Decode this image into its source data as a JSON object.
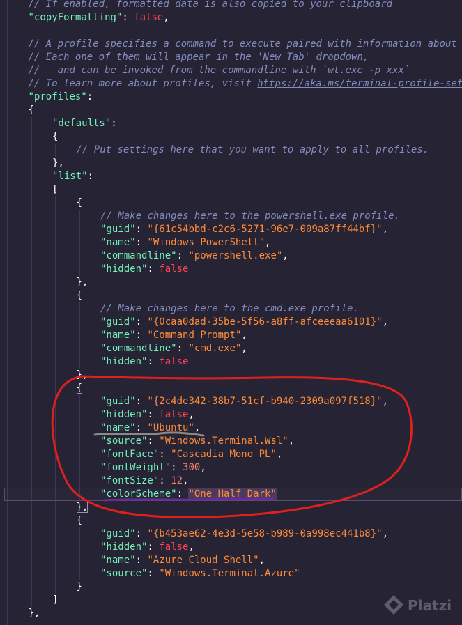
{
  "colors": {
    "background": "#262335",
    "comment": "#848bbd",
    "key": "#72f1b8",
    "string": "#ff8b39",
    "keyword": "#fe4450",
    "number": "#f97e72",
    "punctuation": "#ffffff",
    "annotation_circle": "#e0201f",
    "annotation_underline_gray": "#8a8a8a",
    "annotation_underline_purple": "#6a2a9a",
    "active_line_border": "#5b4c73"
  },
  "editor": {
    "active_line": 37,
    "lines": [
      {
        "indent": 1,
        "tokens": [
          {
            "t": "comment",
            "v": "// If enabled, formatted data is also copied to your clipboard"
          }
        ]
      },
      {
        "indent": 1,
        "tokens": [
          {
            "t": "key",
            "v": "\"copyFormatting\""
          },
          {
            "t": "punc",
            "v": ": "
          },
          {
            "t": "kw",
            "v": "false"
          },
          {
            "t": "punc",
            "v": ","
          }
        ]
      },
      {
        "indent": 1,
        "tokens": []
      },
      {
        "indent": 1,
        "tokens": [
          {
            "t": "comment",
            "v": "// A profile specifies a command to execute paired with information about how it should look and feel."
          }
        ]
      },
      {
        "indent": 1,
        "tokens": [
          {
            "t": "comment",
            "v": "// Each one of them will appear in the 'New Tab' dropdown,"
          }
        ]
      },
      {
        "indent": 1,
        "tokens": [
          {
            "t": "comment",
            "v": "//   and can be invoked from the commandline with `wt.exe -p xxx`"
          }
        ]
      },
      {
        "indent": 1,
        "tokens": [
          {
            "t": "comment",
            "v": "// To learn more about profiles, visit "
          },
          {
            "t": "url",
            "v": "https://aka.ms/terminal-profile-settings"
          }
        ]
      },
      {
        "indent": 1,
        "tokens": [
          {
            "t": "key",
            "v": "\"profiles\""
          },
          {
            "t": "punc",
            "v": ":"
          }
        ]
      },
      {
        "indent": 1,
        "tokens": [
          {
            "t": "punc",
            "v": "{"
          }
        ]
      },
      {
        "indent": 2,
        "tokens": [
          {
            "t": "key",
            "v": "\"defaults\""
          },
          {
            "t": "punc",
            "v": ":"
          }
        ]
      },
      {
        "indent": 2,
        "tokens": [
          {
            "t": "punc",
            "v": "{"
          }
        ]
      },
      {
        "indent": 3,
        "tokens": [
          {
            "t": "comment",
            "v": "// Put settings here that you want to apply to all profiles."
          }
        ]
      },
      {
        "indent": 2,
        "tokens": [
          {
            "t": "punc",
            "v": "},"
          }
        ]
      },
      {
        "indent": 2,
        "tokens": [
          {
            "t": "key",
            "v": "\"list\""
          },
          {
            "t": "punc",
            "v": ":"
          }
        ]
      },
      {
        "indent": 2,
        "tokens": [
          {
            "t": "punc",
            "v": "["
          }
        ]
      },
      {
        "indent": 3,
        "tokens": [
          {
            "t": "punc",
            "v": "{"
          }
        ]
      },
      {
        "indent": 4,
        "tokens": [
          {
            "t": "comment",
            "v": "// Make changes here to the powershell.exe profile."
          }
        ]
      },
      {
        "indent": 4,
        "tokens": [
          {
            "t": "key",
            "v": "\"guid\""
          },
          {
            "t": "punc",
            "v": ": "
          },
          {
            "t": "str",
            "v": "\"{61c54bbd-c2c6-5271-96e7-009a87ff44bf}\""
          },
          {
            "t": "punc",
            "v": ","
          }
        ]
      },
      {
        "indent": 4,
        "tokens": [
          {
            "t": "key",
            "v": "\"name\""
          },
          {
            "t": "punc",
            "v": ": "
          },
          {
            "t": "str",
            "v": "\"Windows PowerShell\""
          },
          {
            "t": "punc",
            "v": ","
          }
        ]
      },
      {
        "indent": 4,
        "tokens": [
          {
            "t": "key",
            "v": "\"commandline\""
          },
          {
            "t": "punc",
            "v": ": "
          },
          {
            "t": "str",
            "v": "\"powershell.exe\""
          },
          {
            "t": "punc",
            "v": ","
          }
        ]
      },
      {
        "indent": 4,
        "tokens": [
          {
            "t": "key",
            "v": "\"hidden\""
          },
          {
            "t": "punc",
            "v": ": "
          },
          {
            "t": "kw",
            "v": "false"
          }
        ]
      },
      {
        "indent": 3,
        "tokens": [
          {
            "t": "punc",
            "v": "},"
          }
        ]
      },
      {
        "indent": 3,
        "tokens": [
          {
            "t": "punc",
            "v": "{"
          }
        ]
      },
      {
        "indent": 4,
        "tokens": [
          {
            "t": "comment",
            "v": "// Make changes here to the cmd.exe profile."
          }
        ]
      },
      {
        "indent": 4,
        "tokens": [
          {
            "t": "key",
            "v": "\"guid\""
          },
          {
            "t": "punc",
            "v": ": "
          },
          {
            "t": "str",
            "v": "\"{0caa0dad-35be-5f56-a8ff-afceeeaa6101}\""
          },
          {
            "t": "punc",
            "v": ","
          }
        ]
      },
      {
        "indent": 4,
        "tokens": [
          {
            "t": "key",
            "v": "\"name\""
          },
          {
            "t": "punc",
            "v": ": "
          },
          {
            "t": "str",
            "v": "\"Command Prompt\""
          },
          {
            "t": "punc",
            "v": ","
          }
        ]
      },
      {
        "indent": 4,
        "tokens": [
          {
            "t": "key",
            "v": "\"commandline\""
          },
          {
            "t": "punc",
            "v": ": "
          },
          {
            "t": "str",
            "v": "\"cmd.exe\""
          },
          {
            "t": "punc",
            "v": ","
          }
        ]
      },
      {
        "indent": 4,
        "tokens": [
          {
            "t": "key",
            "v": "\"hidden\""
          },
          {
            "t": "punc",
            "v": ": "
          },
          {
            "t": "kw",
            "v": "false"
          }
        ]
      },
      {
        "indent": 3,
        "tokens": [
          {
            "t": "punc",
            "v": "},"
          }
        ]
      },
      {
        "indent": 3,
        "tokens": [
          {
            "t": "punc",
            "v": "{",
            "hl": true
          }
        ]
      },
      {
        "indent": 4,
        "tokens": [
          {
            "t": "key",
            "v": "\"guid\""
          },
          {
            "t": "punc",
            "v": ": "
          },
          {
            "t": "str",
            "v": "\"{2c4de342-38b7-51cf-b940-2309a097f518}\""
          },
          {
            "t": "punc",
            "v": ","
          }
        ]
      },
      {
        "indent": 4,
        "tokens": [
          {
            "t": "key",
            "v": "\"hidden\""
          },
          {
            "t": "punc",
            "v": ": "
          },
          {
            "t": "kw",
            "v": "false"
          },
          {
            "t": "punc",
            "v": ","
          }
        ]
      },
      {
        "indent": 4,
        "tokens": [
          {
            "t": "key",
            "v": "\"name\""
          },
          {
            "t": "punc",
            "v": ": "
          },
          {
            "t": "str",
            "v": "\"Ubuntu\""
          },
          {
            "t": "punc",
            "v": ","
          }
        ]
      },
      {
        "indent": 4,
        "tokens": [
          {
            "t": "key",
            "v": "\"source\""
          },
          {
            "t": "punc",
            "v": ": "
          },
          {
            "t": "str",
            "v": "\"Windows.Terminal.Wsl\""
          },
          {
            "t": "punc",
            "v": ","
          }
        ]
      },
      {
        "indent": 4,
        "tokens": [
          {
            "t": "key",
            "v": "\"fontFace\""
          },
          {
            "t": "punc",
            "v": ": "
          },
          {
            "t": "str",
            "v": "\"Cascadia Mono PL\""
          },
          {
            "t": "punc",
            "v": ","
          }
        ]
      },
      {
        "indent": 4,
        "tokens": [
          {
            "t": "key",
            "v": "\"fontWeight\""
          },
          {
            "t": "punc",
            "v": ": "
          },
          {
            "t": "num",
            "v": "300"
          },
          {
            "t": "punc",
            "v": ","
          }
        ]
      },
      {
        "indent": 4,
        "tokens": [
          {
            "t": "key",
            "v": "\"fontSize\""
          },
          {
            "t": "punc",
            "v": ": "
          },
          {
            "t": "num",
            "v": "12"
          },
          {
            "t": "punc",
            "v": ","
          }
        ]
      },
      {
        "indent": 4,
        "tokens": [
          {
            "t": "key",
            "v": "\"colorScheme\""
          },
          {
            "t": "punc",
            "v": ": "
          },
          {
            "t": "str",
            "v": "\"One Half Dark\"",
            "sel": true
          }
        ]
      },
      {
        "indent": 3,
        "tokens": [
          {
            "t": "punc",
            "v": "},",
            "hl": true
          }
        ]
      },
      {
        "indent": 3,
        "tokens": [
          {
            "t": "punc",
            "v": "{"
          }
        ]
      },
      {
        "indent": 4,
        "tokens": [
          {
            "t": "key",
            "v": "\"guid\""
          },
          {
            "t": "punc",
            "v": ": "
          },
          {
            "t": "str",
            "v": "\"{b453ae62-4e3d-5e58-b989-0a998ec441b8}\""
          },
          {
            "t": "punc",
            "v": ","
          }
        ]
      },
      {
        "indent": 4,
        "tokens": [
          {
            "t": "key",
            "v": "\"hidden\""
          },
          {
            "t": "punc",
            "v": ": "
          },
          {
            "t": "kw",
            "v": "false"
          },
          {
            "t": "punc",
            "v": ","
          }
        ]
      },
      {
        "indent": 4,
        "tokens": [
          {
            "t": "key",
            "v": "\"name\""
          },
          {
            "t": "punc",
            "v": ": "
          },
          {
            "t": "str",
            "v": "\"Azure Cloud Shell\""
          },
          {
            "t": "punc",
            "v": ","
          }
        ]
      },
      {
        "indent": 4,
        "tokens": [
          {
            "t": "key",
            "v": "\"source\""
          },
          {
            "t": "punc",
            "v": ": "
          },
          {
            "t": "str",
            "v": "\"Windows.Terminal.Azure\""
          }
        ]
      },
      {
        "indent": 3,
        "tokens": [
          {
            "t": "punc",
            "v": "}"
          }
        ]
      },
      {
        "indent": 2,
        "tokens": [
          {
            "t": "punc",
            "v": "]"
          }
        ]
      },
      {
        "indent": 1,
        "tokens": [
          {
            "t": "punc",
            "v": "},"
          }
        ]
      }
    ]
  },
  "watermark": {
    "text": "Platzi",
    "icon": "platzi-logo-icon"
  }
}
